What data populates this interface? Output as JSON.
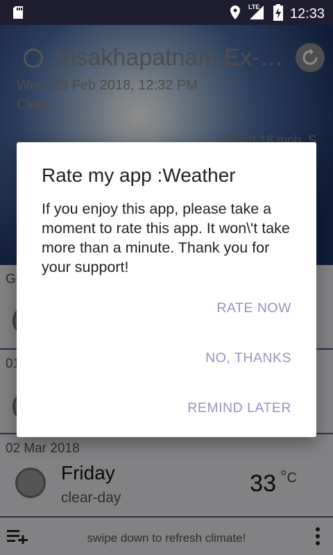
{
  "status_bar": {
    "time": "12:33",
    "network": "LTE",
    "icons": [
      "sd-card-icon",
      "location-icon",
      "signal-icon",
      "battery-charging-icon"
    ]
  },
  "header": {
    "location": "Visakhapatnam,Ex-Se…",
    "datetime": "Wed, 28 Feb 2018, 12:32 PM",
    "condition": "Clear",
    "wind": "Wind:18 mph, S"
  },
  "forecast": [
    {
      "date": "Go",
      "day": "",
      "desc": "",
      "temp": ""
    },
    {
      "date": "01",
      "day": "",
      "desc": "",
      "temp": ""
    },
    {
      "date": "02 Mar 2018",
      "day": "Friday",
      "desc": "clear-day",
      "temp": "33",
      "unit_deg": "°",
      "unit": "C"
    }
  ],
  "bottom_bar": {
    "hint": "swipe down to refresh climate!"
  },
  "dialog": {
    "title": "Rate my app :Weather",
    "message": "If you enjoy this app, please take a moment to rate this app. It won\\'t take more than a minute. Thank you for your support!",
    "buttons": {
      "rate_now": "RATE NOW",
      "no_thanks": "NO, THANKS",
      "remind_later": "REMIND LATER"
    },
    "accent_color": "#9e8fbe"
  }
}
